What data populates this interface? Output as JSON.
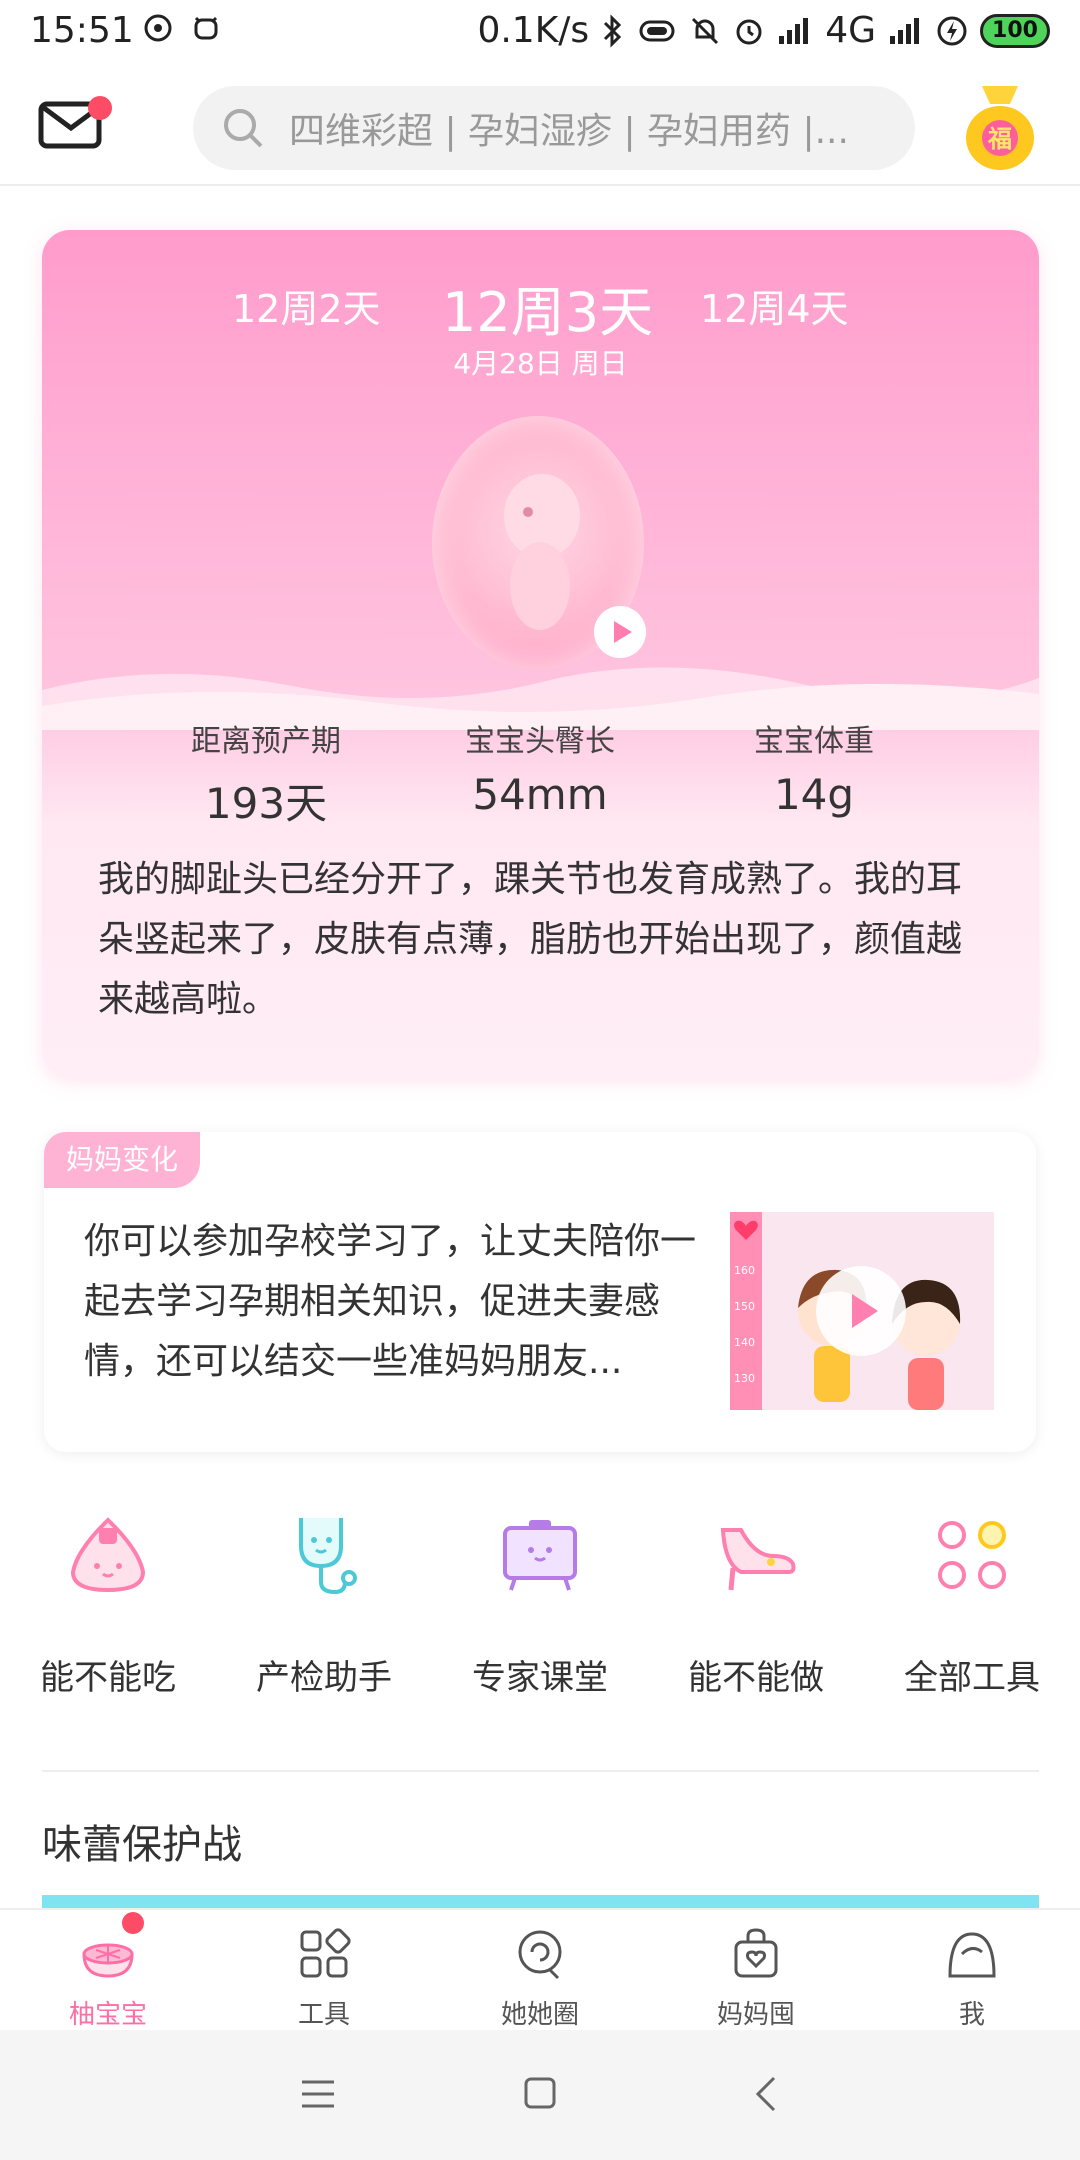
{
  "status_bar": {
    "time": "15:51",
    "network_speed": "0.1K/s",
    "network_type": "4G",
    "battery": "100"
  },
  "header": {
    "search_placeholder": "四维彩超 | 孕妇湿疹 | 孕妇用药 |...",
    "fu_label": "福"
  },
  "pregnancy": {
    "prev_week": "12周2天",
    "current_week": "12周3天",
    "next_week": "12周4天",
    "date": "4月28日 周日",
    "stats": [
      {
        "label": "距离预产期",
        "value": "193天"
      },
      {
        "label": "宝宝头臀长",
        "value": "54mm"
      },
      {
        "label": "宝宝体重",
        "value": "14g"
      }
    ],
    "description": "我的脚趾头已经分开了，踝关节也发育成熟了。我的耳朵竖起来了，皮肤有点薄，脂肪也开始出现了，颜值越来越高啦。"
  },
  "mama_change": {
    "tag": "妈妈变化",
    "text": "你可以参加孕校学习了，让丈夫陪你一起去学习孕期相关知识，促进夫妻感情，还可以结交一些准妈妈朋友...",
    "ruler_marks": [
      "160",
      "150",
      "140",
      "130"
    ]
  },
  "tools": [
    {
      "label": "能不能吃",
      "icon": "rice-ball-icon"
    },
    {
      "label": "产检助手",
      "icon": "stethoscope-icon"
    },
    {
      "label": "专家课堂",
      "icon": "tv-icon"
    },
    {
      "label": "能不能做",
      "icon": "high-heel-icon"
    },
    {
      "label": "全部工具",
      "icon": "grid-dots-icon"
    }
  ],
  "section": {
    "title": "味蕾保护战"
  },
  "bottom_nav": [
    {
      "label": "柚宝宝",
      "icon": "pomelo-icon",
      "active": true
    },
    {
      "label": "工具",
      "icon": "tools-grid-icon",
      "active": false
    },
    {
      "label": "她她圈",
      "icon": "circle-chat-icon",
      "active": false
    },
    {
      "label": "妈妈囤",
      "icon": "shopping-bag-icon",
      "active": false
    },
    {
      "label": "我",
      "icon": "profile-icon",
      "active": false
    }
  ],
  "colors": {
    "brand_pink": "#ff6ea6",
    "card_gradient_top": "#ff9ccc",
    "badge_red": "#ff4c66"
  }
}
